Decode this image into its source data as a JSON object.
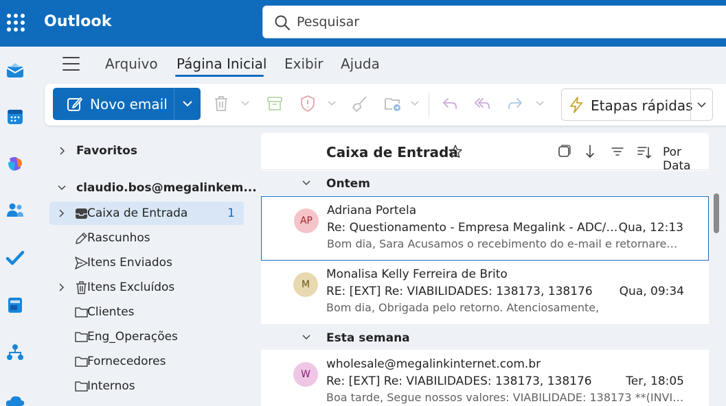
{
  "app": {
    "name": "Outlook"
  },
  "search": {
    "placeholder": "Pesquisar"
  },
  "rail": {
    "icons": [
      "mail-icon",
      "calendar-icon",
      "copilot-icon",
      "people-icon",
      "todo-icon",
      "word-icon",
      "org-explorer-icon",
      "onedrive-icon"
    ]
  },
  "tabs": [
    {
      "label": "Arquivo"
    },
    {
      "label": "Página Inicial",
      "active": true
    },
    {
      "label": "Exibir"
    },
    {
      "label": "Ajuda"
    }
  ],
  "toolbar": {
    "new_mail_label": "Novo email",
    "quick_steps_label": "Etapas rápidas"
  },
  "folders": {
    "favorites_label": "Favoritos",
    "account_label": "claudio.bos@megalinkem...",
    "items": [
      {
        "label": "Caixa de Entrada",
        "count": "1",
        "selected": true
      },
      {
        "label": "Rascunhos"
      },
      {
        "label": "Itens Enviados"
      },
      {
        "label": "Itens Excluídos"
      },
      {
        "label": "Clientes"
      },
      {
        "label": "Eng_Operações"
      },
      {
        "label": "Fornecedores"
      },
      {
        "label": "Internos"
      }
    ]
  },
  "list": {
    "title": "Caixa de Entrada",
    "sort_label": "Por Data",
    "groups": [
      {
        "label": "Ontem"
      },
      {
        "label": "Esta semana"
      }
    ],
    "messages": [
      {
        "initials": "AP",
        "avatar_bg": "#f4c4c8",
        "avatar_fg": "#a4262c",
        "sender": "Adriana Portela",
        "subject": "Re: Questionamento - Empresa Megalink - ADC/1...",
        "time": "Qua, 12:13",
        "preview": "Bom dia, Sara Acusamos o recebimento do e-mail e retornarem..."
      },
      {
        "initials": "M",
        "avatar_bg": "#e8d9b0",
        "avatar_fg": "#6b5418",
        "sender": "Monalisa Kelly Ferreira de Brito",
        "subject": "RE: [EXT] Re: VIABILIDADES: 138173, 138176",
        "time": "Qua, 09:34",
        "preview": "Bom dia, Obrigada pelo retorno. Atenciosamente,"
      },
      {
        "initials": "W",
        "avatar_bg": "#efc6e6",
        "avatar_fg": "#8a1d73",
        "sender": "wholesale@megalinkinternet.com.br",
        "subject": "Re: [EXT] Re: VIABILIDADES: 138173, 138176",
        "time": "Ter, 18:05",
        "preview": "Boa tarde, Segue nossos valores: VIABILIDADE: 138173 **(INVIÁ..."
      }
    ]
  },
  "colors": {
    "brand": "#0f6cbd",
    "selected_folder": "#d8e6f5",
    "unread_count": "#0f6cbd"
  }
}
